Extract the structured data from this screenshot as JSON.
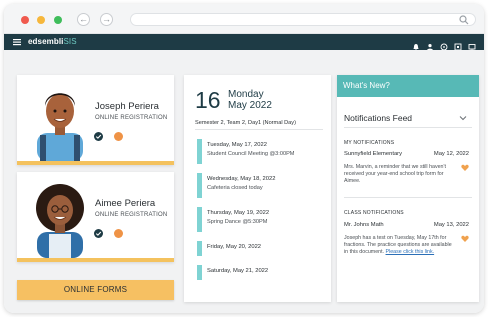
{
  "browser": {
    "back_icon": "arrow-left-icon",
    "forward_icon": "arrow-right-icon",
    "search_icon": "search-icon"
  },
  "app": {
    "brand_name": "edsembli",
    "brand_suffix": "SIS",
    "top_icons": [
      "bell-icon",
      "user-icon",
      "help-icon",
      "settings-icon",
      "logout-icon"
    ]
  },
  "students": [
    {
      "name": "Joseph Periera",
      "subtitle": "ONLINE REGISTRATION",
      "status_color": "#ef9346"
    },
    {
      "name": "Aimee Periera",
      "subtitle": "ONLINE REGISTRATION",
      "status_color": "#ef9346"
    }
  ],
  "online_forms_label": "ONLINE FORMS",
  "calendar": {
    "day_number": "16",
    "weekday": "Monday",
    "month_year": "May 2022",
    "semester": "Semester 2, Team 2, Day1 (Normal Day)",
    "events": [
      {
        "date": "Tuesday, May 17, 2022",
        "description": "Student Council Meeting @3:00PM"
      },
      {
        "date": "Wednesday, May 18, 2022",
        "description": "Cafeteria closed today"
      },
      {
        "date": "Thursday, May 19, 2022",
        "description": "Spring Dance @5:30PM"
      },
      {
        "date": "Friday, May 20, 2022",
        "description": ""
      },
      {
        "date": "Saturday, May 21, 2022",
        "description": ""
      }
    ]
  },
  "news": {
    "header": "What's New?",
    "feed_title": "Notifications Feed",
    "my_section": "MY NOTIFICATIONS",
    "my_source": "Sunnyfield Elementary",
    "my_date": "May 12, 2022",
    "my_message": "Mrs. Marvin, a reminder that we still haven't received your year-end school trip form for Aimee.",
    "class_section": "CLASS NOTIFICATIONS",
    "class_source": "Mr. Johns Math",
    "class_date": "May 13, 2022",
    "class_message": "Joseph has a test on Tuesday, May 17th for fractions. The practice questions are available in this document.",
    "class_link": "Please click this link."
  }
}
